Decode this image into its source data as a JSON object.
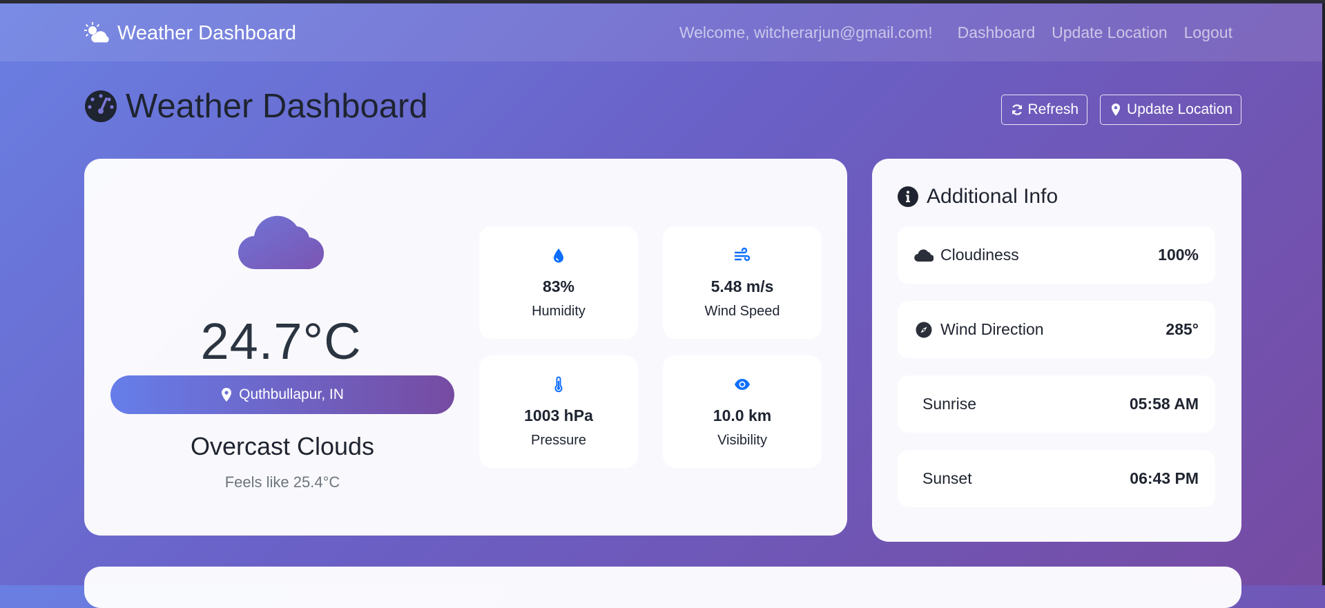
{
  "nav": {
    "brand": "Weather Dashboard",
    "welcome": "Welcome, witcherarjun@gmail.com!",
    "links": [
      "Dashboard",
      "Update Location",
      "Logout"
    ]
  },
  "header": {
    "title": "Weather Dashboard",
    "refresh_label": "Refresh",
    "update_location_label": "Update Location"
  },
  "current": {
    "condition_icon": "cloud-icon",
    "temperature": "24.7°C",
    "location": "Quthbullapur, IN",
    "description": "Overcast Clouds",
    "feels_like": "Feels like 25.4°C"
  },
  "stats": [
    {
      "icon": "droplet-icon",
      "value": "83%",
      "label": "Humidity"
    },
    {
      "icon": "wind-icon",
      "value": "5.48 m/s",
      "label": "Wind Speed"
    },
    {
      "icon": "thermometer-icon",
      "value": "1003 hPa",
      "label": "Pressure"
    },
    {
      "icon": "eye-icon",
      "value": "10.0 km",
      "label": "Visibility"
    }
  ],
  "additional": {
    "title": "Additional Info",
    "rows": [
      {
        "icon": "cloud-icon",
        "label": "Cloudiness",
        "value": "100%"
      },
      {
        "icon": "compass-icon",
        "label": "Wind Direction",
        "value": "285°"
      },
      {
        "label": "Sunrise",
        "value": "05:58 AM"
      },
      {
        "label": "Sunset",
        "value": "06:43 PM"
      }
    ]
  },
  "colors": {
    "accent": "#0d6efd",
    "gradient_start": "#667eea",
    "gradient_end": "#764ba2",
    "cloud": "#7466c9"
  }
}
